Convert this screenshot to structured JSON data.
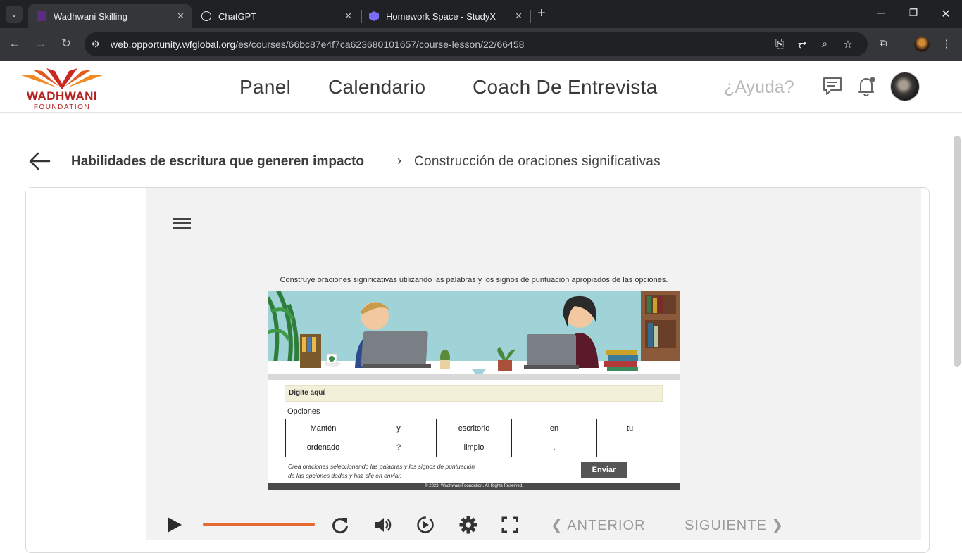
{
  "browser": {
    "tabs": [
      {
        "title": "Wadhwani Skilling",
        "close": "✕",
        "active": true
      },
      {
        "title": "ChatGPT",
        "close": "✕",
        "active": false
      },
      {
        "title": "Homework Space - StudyX",
        "close": "✕",
        "active": false
      }
    ],
    "new_tab": "+",
    "url_host": "web.opportunity.wfglobal.org",
    "url_path": "/es/courses/66bc87e4f7ca623680101657/course-lesson/22/66458"
  },
  "site": {
    "logo_name": "WADHWANI",
    "logo_sub": "FOUNDATION",
    "nav": [
      "Panel",
      "Calendario",
      "Coach De Entrevista"
    ],
    "help": "¿Ayuda?",
    "icons": [
      "chat-icon",
      "bell-icon",
      "avatar"
    ]
  },
  "breadcrumb": {
    "course": "Habilidades de escritura que generen impacto",
    "lesson": "Construcción de oraciones significativas"
  },
  "slide": {
    "instruction": "Construye oraciones significativas utilizando las palabras y los signos de puntuación apropiados de las opciones.",
    "input_placeholder": "Digite aquí",
    "options_label": "Opciones",
    "options": [
      [
        "Mantén",
        "y",
        "escritorio",
        "en",
        "tu"
      ],
      [
        "ordenado",
        "?",
        "limpio",
        ".",
        "."
      ]
    ],
    "hint_line1": "Crea oraciones seleccionando las palabras y los signos de puntuación",
    "hint_line2": "de las opciones dadas y haz clic en enviar.",
    "send_label": "Enviar",
    "footer": "© 2023, Wadhwani Foundation. All Rights Reserved."
  },
  "player": {
    "progress": 1.0,
    "prev_label": "ANTERIOR",
    "next_label": "SIGUIENTE"
  },
  "colors": {
    "brand": "#b2221e",
    "progress": "#e8692f",
    "tab_bg": "#202124",
    "toolbar_bg": "#35363a"
  }
}
